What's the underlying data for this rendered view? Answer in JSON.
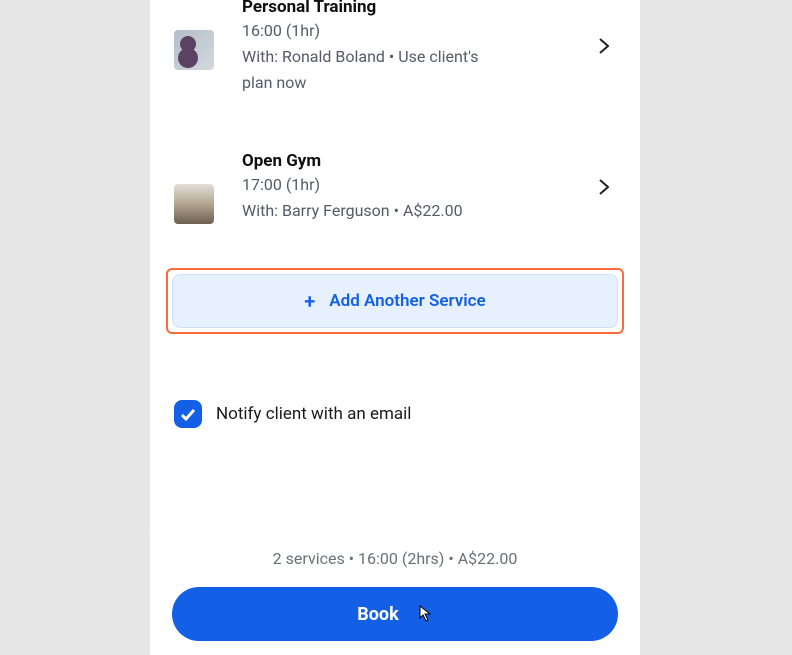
{
  "services": [
    {
      "title": "Personal Training",
      "time": "16:00 (1hr)",
      "with": "With: Ronald Boland  •  Use client's plan now"
    },
    {
      "title": "Open Gym",
      "time": "17:00 (1hr)",
      "with": "With: Barry Ferguson  •  A$22.00"
    }
  ],
  "add_button": "Add Another Service",
  "notify_label": "Notify client with an email",
  "summary": "2 services • 16:00 (2hrs) • A$22.00",
  "book_label": "Book"
}
